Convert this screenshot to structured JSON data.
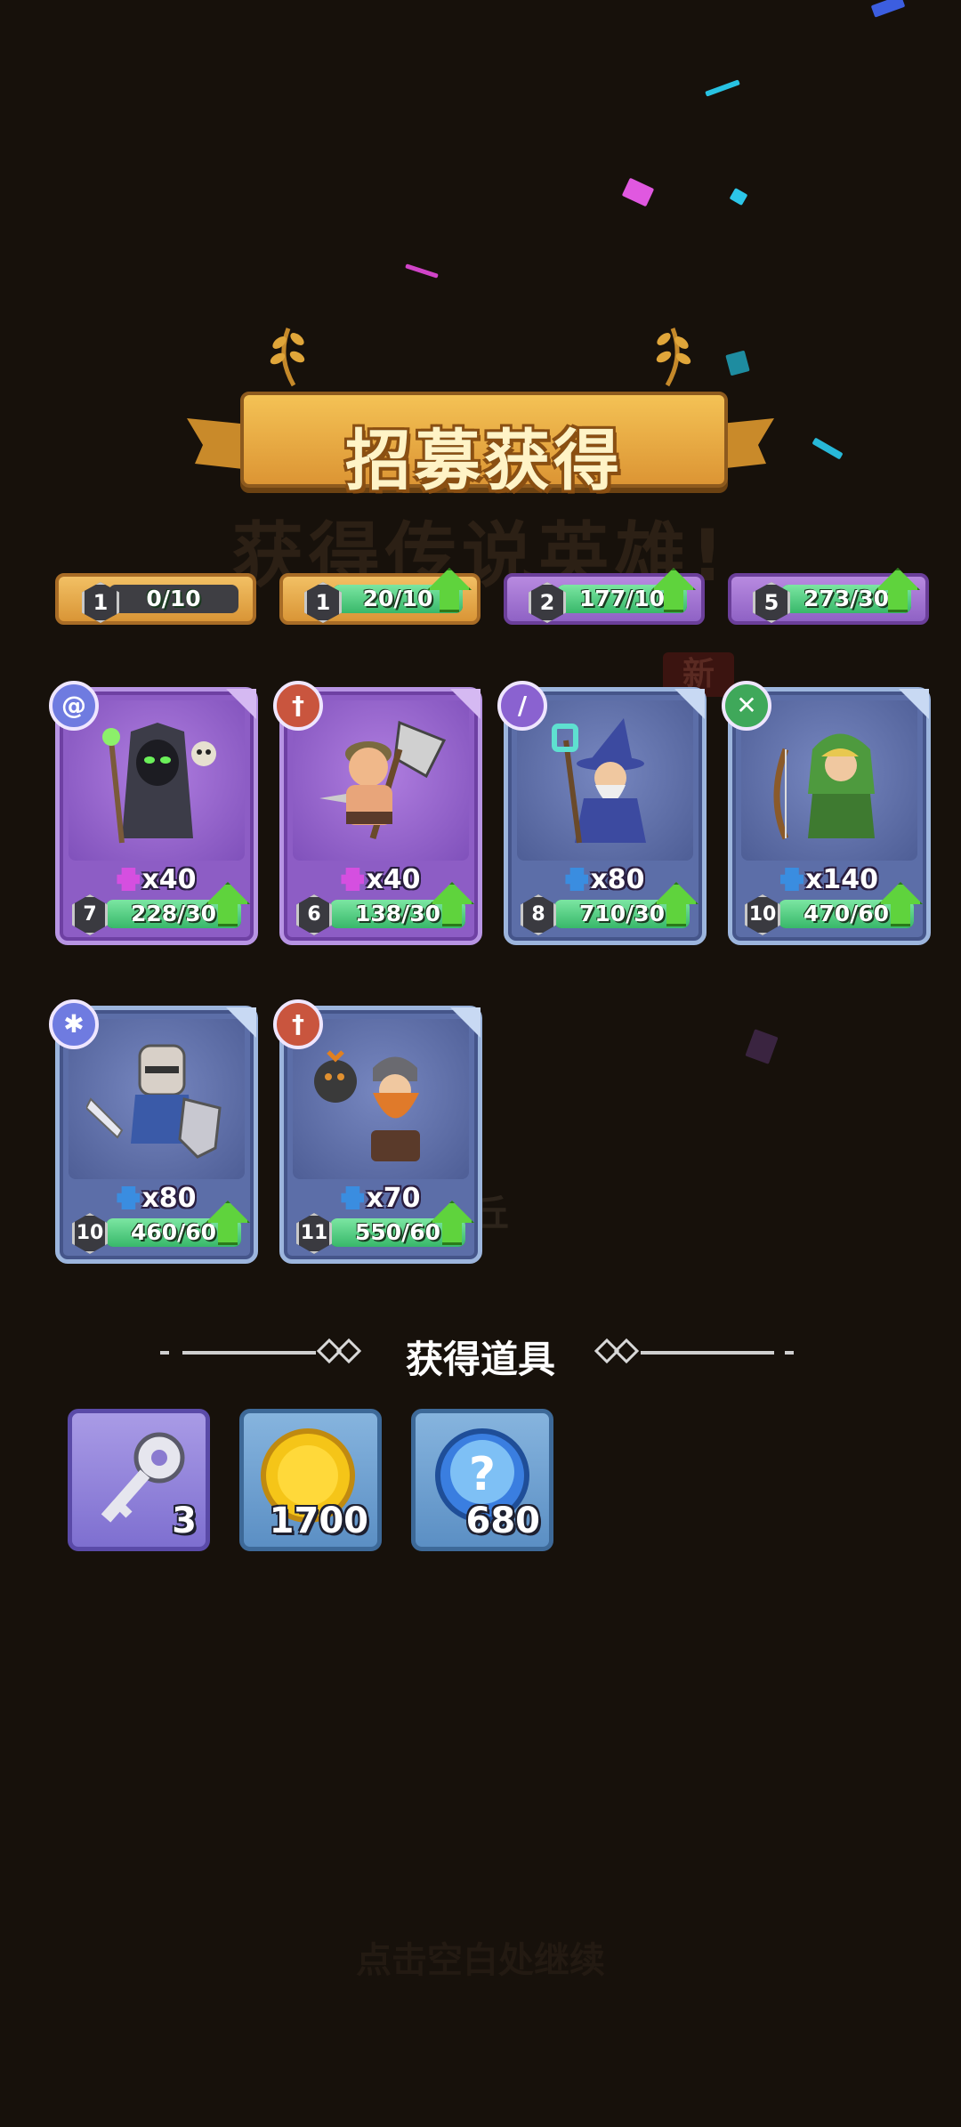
{
  "banner": {
    "title": "招募获得"
  },
  "background_text": {
    "subtitle": "获得传说英雄!",
    "new_badge": "新",
    "hero_name_fragment": "丘",
    "continue_hint": "点击空白处继续"
  },
  "top_row": [
    {
      "level": "1",
      "progress": "0/10",
      "fill": 0.0,
      "style": "gold",
      "upgrade": false
    },
    {
      "level": "1",
      "progress": "20/10",
      "fill": 1.0,
      "style": "gold",
      "upgrade": true
    },
    {
      "level": "2",
      "progress": "177/10",
      "fill": 1.0,
      "style": "purple",
      "upgrade": true
    },
    {
      "level": "5",
      "progress": "273/30",
      "fill": 1.0,
      "style": "purple",
      "upgrade": true
    }
  ],
  "heroes": [
    {
      "name": "necromancer",
      "class_icon": "spiral-icon",
      "class_color": "#6f7be0",
      "rarity": "purple",
      "shards": "x40",
      "shard_color": "#d54fe0",
      "level": "7",
      "progress": "228/30",
      "fill": 1.0
    },
    {
      "name": "barbarian",
      "class_icon": "sword-icon",
      "class_color": "#c9553e",
      "rarity": "purple",
      "shards": "x40",
      "shard_color": "#d54fe0",
      "level": "6",
      "progress": "138/30",
      "fill": 1.0
    },
    {
      "name": "wizard",
      "class_icon": "staff-icon",
      "class_color": "#8a62d0",
      "rarity": "blue",
      "shards": "x80",
      "shard_color": "#3a8de0",
      "level": "8",
      "progress": "710/30",
      "fill": 1.0
    },
    {
      "name": "ranger",
      "class_icon": "bow-icon",
      "class_color": "#3fa85a",
      "rarity": "blue",
      "shards": "x140",
      "shard_color": "#3a8de0",
      "level": "10",
      "progress": "470/60",
      "fill": 1.0
    },
    {
      "name": "knight",
      "class_icon": "paw-icon",
      "class_color": "#6f7be0",
      "rarity": "blue",
      "shards": "x80",
      "shard_color": "#3a8de0",
      "level": "10",
      "progress": "460/60",
      "fill": 1.0
    },
    {
      "name": "dwarf",
      "class_icon": "sword-icon",
      "class_color": "#c9553e",
      "rarity": "blue",
      "shards": "x70",
      "shard_color": "#3a8de0",
      "level": "11",
      "progress": "550/60",
      "fill": 1.0
    }
  ],
  "items_section": {
    "title": "获得道具",
    "items": [
      {
        "icon": "key-icon",
        "count": "3",
        "style": "purple"
      },
      {
        "icon": "gold-coin-icon",
        "count": "1700",
        "style": "blue"
      },
      {
        "icon": "mystery-orb-icon",
        "count": "680",
        "style": "blue"
      }
    ]
  },
  "colors": {
    "background": "#17110b",
    "progress_fill": "#4fcf7f",
    "upgrade_arrow": "#5fd33d"
  }
}
